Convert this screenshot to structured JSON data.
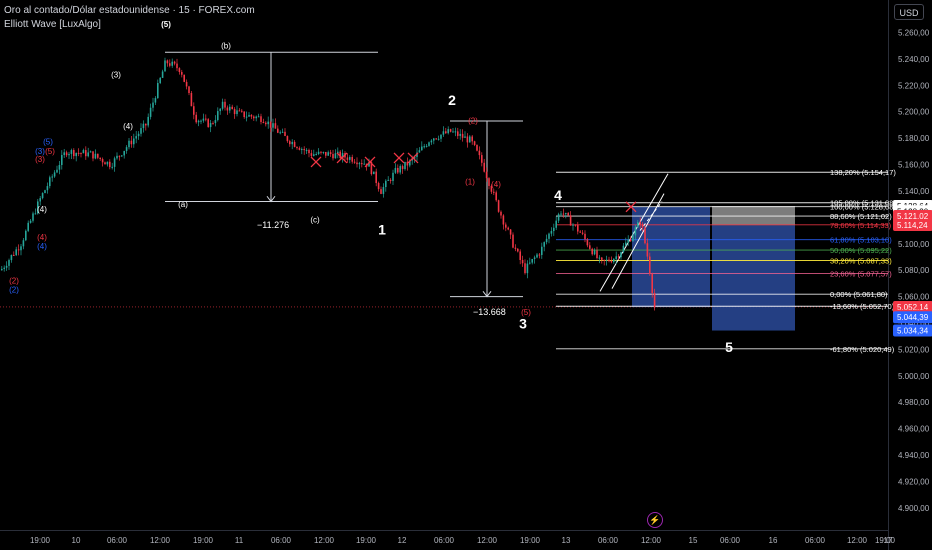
{
  "header": {
    "title": "Oro al contado/Dólar estadounidense · 15 · FOREX.com",
    "indicator": "Elliott Wave [LuxAlgo]"
  },
  "currency_button": "USD",
  "time_axis": {
    "labels": [
      "19:00",
      "10",
      "06:00",
      "12:00",
      "19:00",
      "11",
      "06:00",
      "12:00",
      "19:00",
      "12",
      "06:00",
      "12:00",
      "19:00",
      "13",
      "06:00",
      "12:00",
      "15",
      "06:00",
      "16",
      "06:00",
      "12:00",
      "19:00",
      "17"
    ]
  },
  "colors": {
    "bull": "#26a69a",
    "bear": "#f23645",
    "fib_blue": "#2962ff",
    "wave_red": "#f23645",
    "wave_blue": "#2962ff",
    "white": "#ffffff"
  },
  "chart_data": {
    "type": "candlestick",
    "symbol": "XAUUSD",
    "timeframe": "15",
    "ylim": [
      4900,
      5270
    ],
    "price_ticks": [
      "5.260,00",
      "5.240,00",
      "5.220,00",
      "5.200,00",
      "5.180,00",
      "5.160,00",
      "5.140,00",
      "5.120,00",
      "5.100,00",
      "5.080,00",
      "5.060,00",
      "5.040,00",
      "5.020,00",
      "5.000,00",
      "4.980,00",
      "4.960,00",
      "4.940,00",
      "4.920,00",
      "4.900,00"
    ],
    "price_tick_values": [
      5260,
      5240,
      5220,
      5200,
      5180,
      5160,
      5140,
      5120,
      5100,
      5080,
      5060,
      5040,
      5020,
      5000,
      4980,
      4960,
      4940,
      4920,
      4900
    ],
    "price_path_anchors": [
      [
        0,
        5080
      ],
      [
        20,
        5100
      ],
      [
        40,
        5135
      ],
      [
        65,
        5170
      ],
      [
        90,
        5168
      ],
      [
        110,
        5160
      ],
      [
        145,
        5190
      ],
      [
        165,
        5238
      ],
      [
        180,
        5232
      ],
      [
        195,
        5195
      ],
      [
        210,
        5190
      ],
      [
        222,
        5205
      ],
      [
        240,
        5198
      ],
      [
        262,
        5195
      ],
      [
        285,
        5180
      ],
      [
        310,
        5168
      ],
      [
        330,
        5168
      ],
      [
        350,
        5165
      ],
      [
        368,
        5160
      ],
      [
        380,
        5140
      ],
      [
        395,
        5155
      ],
      [
        410,
        5162
      ],
      [
        430,
        5180
      ],
      [
        450,
        5185
      ],
      [
        470,
        5178
      ],
      [
        482,
        5160
      ],
      [
        497,
        5128
      ],
      [
        512,
        5100
      ],
      [
        524,
        5080
      ],
      [
        540,
        5095
      ],
      [
        560,
        5125
      ],
      [
        580,
        5108
      ],
      [
        600,
        5085
      ],
      [
        615,
        5090
      ],
      [
        630,
        5105
      ],
      [
        640,
        5118
      ],
      [
        648,
        5085
      ],
      [
        655,
        5045
      ]
    ],
    "price_labels": [
      {
        "text": "5.128,64",
        "value": 5128.64,
        "bg": "#ffffff",
        "fg": "#000000"
      },
      {
        "text": "5.128,30",
        "value": 5124.6,
        "bg": "#ffffff",
        "fg": "#000000"
      },
      {
        "text": "5.121,02",
        "value": 5121.02,
        "bg": "#f23645",
        "fg": "#ffffff"
      },
      {
        "text": "5.114,24",
        "value": 5114.24,
        "bg": "#f23645",
        "fg": "#ffffff"
      },
      {
        "text": "5.052,14",
        "value": 5052.14,
        "bg": "#f23645",
        "fg": "#ffffff"
      },
      {
        "text": "03:45",
        "value": 5045.5,
        "bg": "#f23645",
        "fg": "#ffffff"
      },
      {
        "text": "5.044,39",
        "value": 5044.39,
        "bg": "#2962ff",
        "fg": "#ffffff"
      },
      {
        "text": "5.034,34",
        "value": 5034.34,
        "bg": "#2962ff",
        "fg": "#ffffff"
      }
    ],
    "fib_levels": [
      {
        "label": "138,20% (5.154,17)",
        "value": 5154.17,
        "color": "#ffffff"
      },
      {
        "label": "105,00% (5.131,08)",
        "value": 5131.08,
        "color": "#ffffff"
      },
      {
        "label": "100,00% (5.128,08)",
        "value": 5128.08,
        "color": "#ffffff"
      },
      {
        "label": "88,60% (5.121,02)",
        "value": 5121.02,
        "color": "#ffffff"
      },
      {
        "label": "78,60% (5.114,33)",
        "value": 5114.33,
        "color": "#f23645"
      },
      {
        "label": "61,80% (5.103,10)",
        "value": 5103.1,
        "color": "#2962ff"
      },
      {
        "label": "50,00% (5.095,22)",
        "value": 5095.22,
        "color": "#4caf50"
      },
      {
        "label": "38,20% (5.087,33)",
        "value": 5087.33,
        "color": "#ffeb3b"
      },
      {
        "label": "23,60% (5.077,57)",
        "value": 5077.57,
        "color": "#f06292"
      },
      {
        "label": "0,00% (5.061,80)",
        "value": 5061.8,
        "color": "#ffffff"
      },
      {
        "label": "-13,60% (5.052,70)",
        "value": 5052.7,
        "color": "#ffffff"
      },
      {
        "label": "-61,80% (5.020,49)",
        "value": 5020.49,
        "color": "#ffffff"
      }
    ],
    "measurements": [
      "−11.276",
      "−13.668"
    ],
    "wave_labels": [
      {
        "text": "(5)",
        "value": 5264,
        "color": "#ffffff",
        "bold": true
      },
      {
        "text": "(b)",
        "value": 5248,
        "color": "#ffffff"
      },
      {
        "text": "(3)",
        "value": 5226,
        "color": "#ffffff"
      },
      {
        "text": "2",
        "value": 5205,
        "color": "#ffffff",
        "big": true
      },
      {
        "text": "(2)",
        "value": 5191,
        "color": "#f23645"
      },
      {
        "text": "(4)",
        "value": 5187,
        "color": "#ffffff"
      },
      {
        "text": "(5)",
        "value": 5175,
        "color": "#2962ff"
      },
      {
        "text": "(3)",
        "value": 5168,
        "color": "#2962ff"
      },
      {
        "text": "(5)",
        "value": 5168,
        "color": "#f23645"
      },
      {
        "text": "(3)",
        "value": 5162,
        "color": "#f23645"
      },
      {
        "text": "(1)",
        "value": 5145,
        "color": "#f23645"
      },
      {
        "text": "(4)",
        "value": 5143,
        "color": "#f23645"
      },
      {
        "text": "4",
        "value": 5133,
        "color": "#ffffff",
        "big": true
      },
      {
        "text": "(a)",
        "value": 5128,
        "color": "#ffffff"
      },
      {
        "text": "(4)",
        "value": 5124,
        "color": "#ffffff"
      },
      {
        "text": "(c)",
        "value": 5116,
        "color": "#ffffff"
      },
      {
        "text": "1",
        "value": 5107,
        "color": "#ffffff",
        "big": true
      },
      {
        "text": "(4)",
        "value": 5103,
        "color": "#f23645"
      },
      {
        "text": "(4)",
        "value": 5096,
        "color": "#2962ff"
      },
      {
        "text": "(2)",
        "value": 5070,
        "color": "#f23645"
      },
      {
        "text": "(2)",
        "value": 5063,
        "color": "#2962ff"
      },
      {
        "text": "(5)",
        "value": 5046,
        "color": "#f23645"
      },
      {
        "text": "3",
        "value": 5036,
        "color": "#ffffff",
        "big": true
      },
      {
        "text": "5",
        "value": 5018,
        "color": "#ffffff",
        "big": true
      }
    ]
  }
}
